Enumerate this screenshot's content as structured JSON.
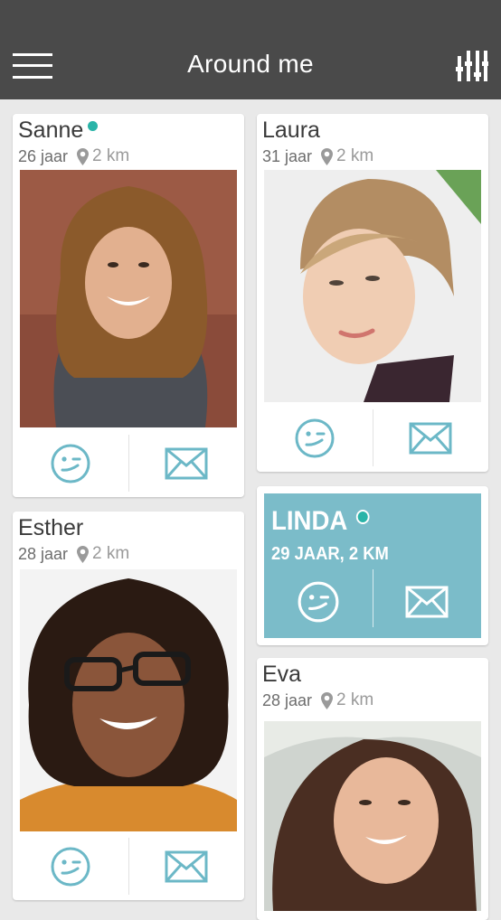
{
  "header": {
    "title": "Around me"
  },
  "icons": {
    "menu": "hamburger-menu-icon",
    "filter": "sliders-icon",
    "wink": "wink-face-icon",
    "message": "envelope-icon",
    "location": "location-pin-icon"
  },
  "colors": {
    "header_bg": "#4a4a4a",
    "accent": "#6cb8c7",
    "online": "#2ab4a8",
    "highlight_bg": "#7bbcc9"
  },
  "profiles": [
    {
      "name": "Sanne",
      "age": "26 jaar",
      "distance": "2 km",
      "online": true
    },
    {
      "name": "Laura",
      "age": "31 jaar",
      "distance": "2 km",
      "online": false
    },
    {
      "name": "Esther",
      "age": "28 jaar",
      "distance": "2 km",
      "online": false
    },
    {
      "name": "Eva",
      "age": "28 jaar",
      "distance": "2 km",
      "online": false
    }
  ],
  "highlight": {
    "name": "LINDA",
    "meta": "29 JAAR, 2 KM",
    "online": true
  }
}
